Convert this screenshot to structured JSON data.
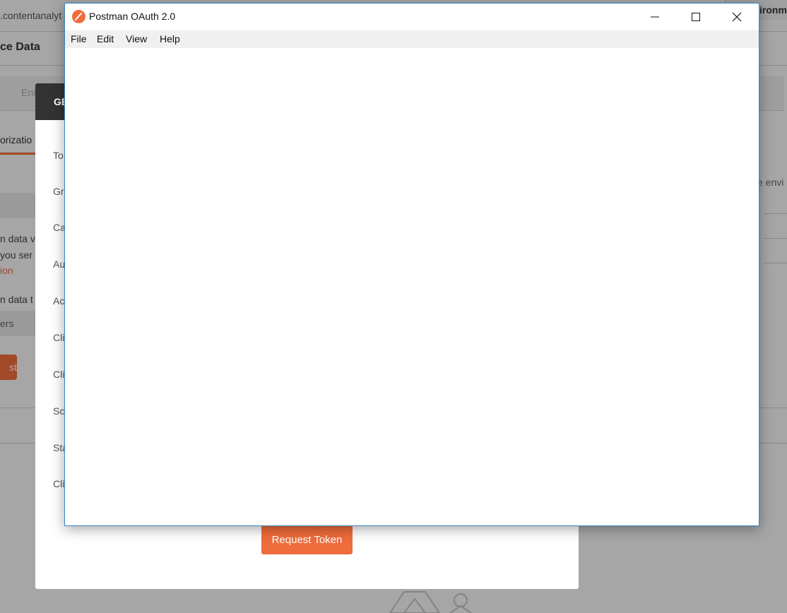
{
  "background": {
    "url_fragment": ".contentanalyt",
    "page_title": "ce Data",
    "input_stub": "Ent",
    "auth_tab": "orizatio",
    "right_tab": "ironm",
    "right_text": "e envi",
    "line1": "n data v",
    "line2": "you ser",
    "link": "ion",
    "line3": "n data t",
    "select_stub": "ers",
    "button_stub": "st"
  },
  "modal": {
    "header": "GE",
    "fields": [
      "To",
      "Gr",
      "Ca",
      "Au",
      "Ac",
      "Cli",
      "Cli",
      "Sc",
      "Sta",
      "Cli"
    ],
    "request_button": "Request Token"
  },
  "window": {
    "title": "Postman OAuth 2.0",
    "icon": "postman-icon",
    "menu": [
      "File",
      "Edit",
      "View",
      "Help"
    ],
    "controls": [
      "minimize-icon",
      "maximize-icon",
      "close-icon"
    ]
  },
  "colors": {
    "accent": "#ef6c3c",
    "window_border": "#3a86c8",
    "modal_header": "#333333"
  }
}
